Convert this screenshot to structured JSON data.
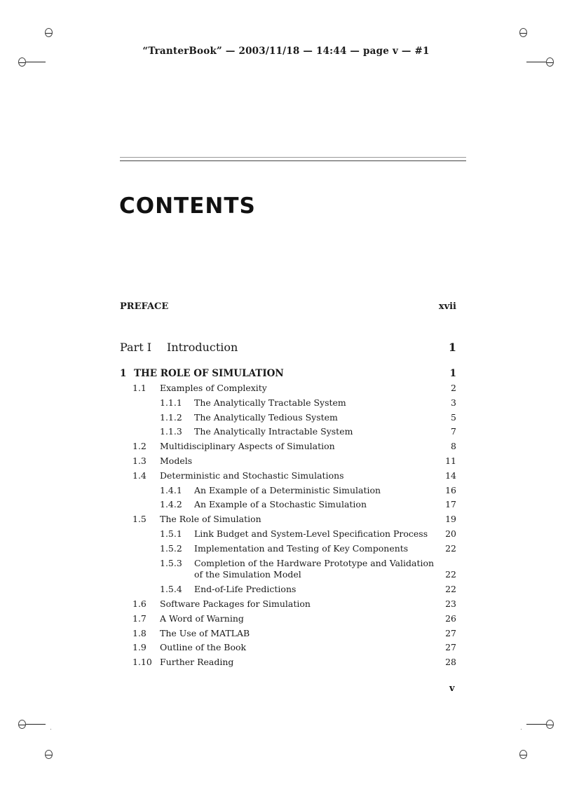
{
  "header": {
    "text": "“TranterBook” — 2003/11/18 — 14:44 — page v — #1"
  },
  "title": "CONTENTS",
  "preface": {
    "label": "PREFACE",
    "page": "xvii"
  },
  "part": {
    "label": "Part I",
    "title": "Introduction",
    "page": "1"
  },
  "chapter": {
    "num": "1",
    "title": "THE ROLE OF SIMULATION",
    "page": "1"
  },
  "entries": [
    {
      "level": 1,
      "num": "1.1",
      "title": "Examples of Complexity",
      "page": "2"
    },
    {
      "level": 2,
      "num": "1.1.1",
      "title": "The Analytically Tractable System",
      "page": "3"
    },
    {
      "level": 2,
      "num": "1.1.2",
      "title": "The Analytically Tedious System",
      "page": "5"
    },
    {
      "level": 2,
      "num": "1.1.3",
      "title": "The Analytically Intractable System",
      "page": "7"
    },
    {
      "level": 1,
      "num": "1.2",
      "title": "Multidisciplinary Aspects of Simulation",
      "page": "8"
    },
    {
      "level": 1,
      "num": "1.3",
      "title": "Models",
      "page": "11"
    },
    {
      "level": 1,
      "num": "1.4",
      "title": "Deterministic and Stochastic Simulations",
      "page": "14"
    },
    {
      "level": 2,
      "num": "1.4.1",
      "title": "An Example of a Deterministic Simulation",
      "page": "16"
    },
    {
      "level": 2,
      "num": "1.4.2",
      "title": "An Example of a Stochastic Simulation",
      "page": "17"
    },
    {
      "level": 1,
      "num": "1.5",
      "title": "The Role of Simulation",
      "page": "19"
    },
    {
      "level": 2,
      "num": "1.5.1",
      "title": "Link Budget and System-Level Specification Process",
      "page": "20"
    },
    {
      "level": 2,
      "num": "1.5.2",
      "title": "Implementation and Testing of Key Components",
      "page": "22"
    },
    {
      "level": 2,
      "num": "1.5.3",
      "title": "Completion of the Hardware Prototype and Validation",
      "title2": "of the Simulation Model",
      "page": "22"
    },
    {
      "level": 2,
      "num": "1.5.4",
      "title": "End-of-Life Predictions",
      "page": "22"
    },
    {
      "level": 1,
      "num": "1.6",
      "title": "Software Packages for Simulation",
      "page": "23"
    },
    {
      "level": 1,
      "num": "1.7",
      "title": "A Word of Warning",
      "page": "26"
    },
    {
      "level": 1,
      "num": "1.8",
      "title": "The Use of MATLAB",
      "page": "27"
    },
    {
      "level": 1,
      "num": "1.9",
      "title": "Outline of the Book",
      "page": "27"
    },
    {
      "level": 1,
      "num": "1.10",
      "title": "Further Reading",
      "page": "28"
    }
  ],
  "footer": {
    "page_number": "v"
  }
}
